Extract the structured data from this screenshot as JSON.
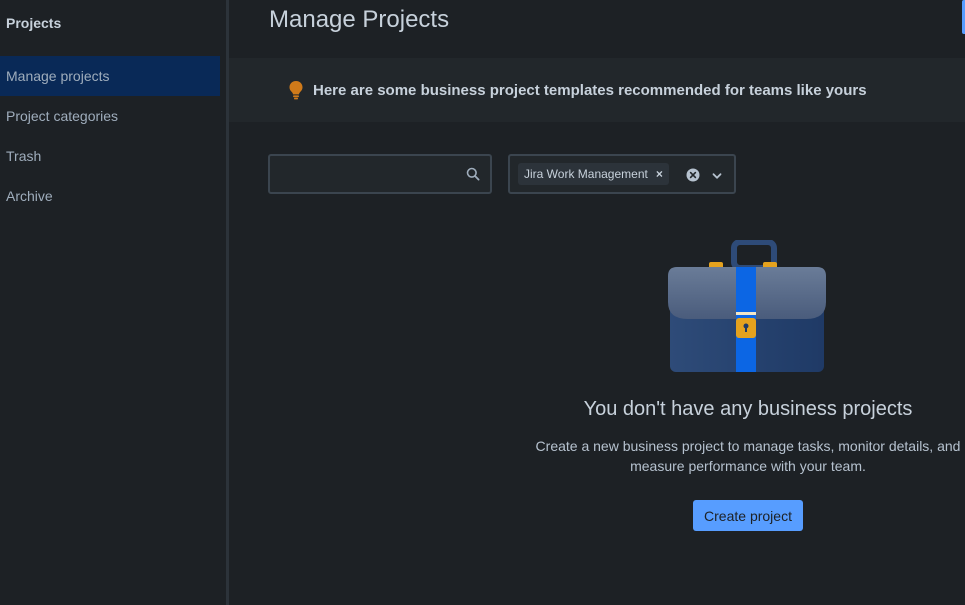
{
  "sidebar": {
    "header": "Projects",
    "items": [
      {
        "label": "Manage projects",
        "active": true
      },
      {
        "label": "Project categories"
      },
      {
        "label": "Trash"
      },
      {
        "label": "Archive"
      }
    ]
  },
  "main": {
    "title": "Manage Projects",
    "banner": {
      "icon": "lightbulb-icon",
      "text": "Here are some business project templates recommended for teams like yours"
    },
    "search": {
      "value": "",
      "placeholder": ""
    },
    "filter": {
      "chip_label": "Jira Work Management",
      "chip_remove": "×"
    },
    "empty_state": {
      "illustration": "briefcase-illustration",
      "title": "You don't have any business projects",
      "description": "Create a new business project to manage tasks, monitor details, and measure performance with your team.",
      "button_label": "Create project"
    }
  },
  "colors": {
    "background": "#1d2125",
    "sidebar_active": "#092957",
    "banner": "#22272b",
    "accent": "#579dff",
    "bulb": "#cf7a1a"
  }
}
